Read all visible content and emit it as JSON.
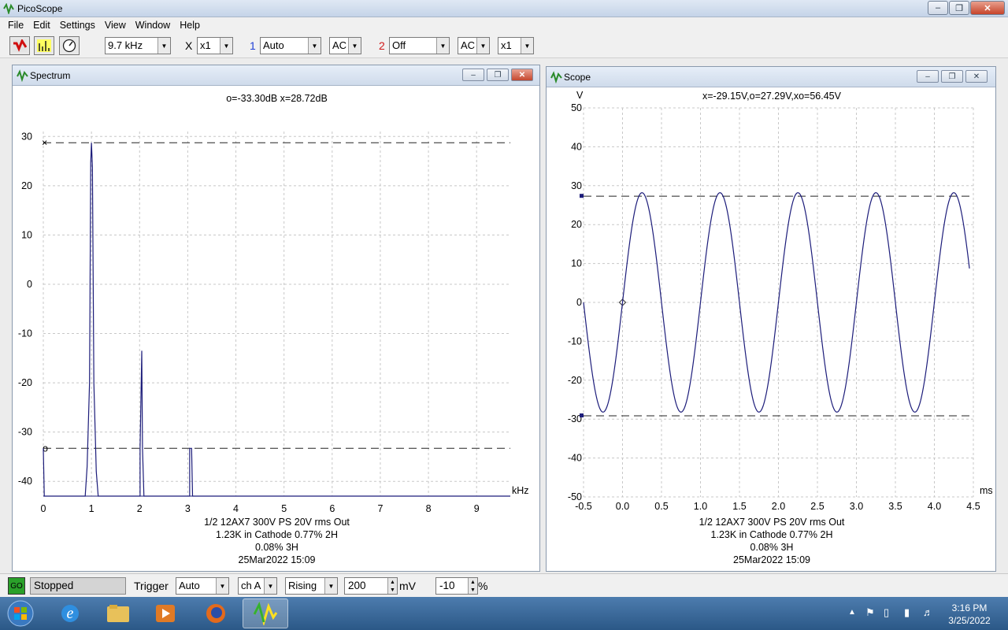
{
  "app": {
    "title": "PicoScope"
  },
  "menu": [
    "File",
    "Edit",
    "Settings",
    "View",
    "Window",
    "Help"
  ],
  "toolbar": {
    "frequency": "9.7 kHz",
    "mult_prefix": "X",
    "multiplier": "x1",
    "ch1_label": "1",
    "ch1_range": "Auto",
    "ch1_coupling": "AC",
    "ch2_label": "2",
    "ch2_range": "Off",
    "ch2_coupling": "AC",
    "multiplier2": "x1"
  },
  "spectrum": {
    "title": "Spectrum",
    "readout": "o=-33.30dB  x=28.72dB",
    "unit_x": "kHz",
    "caption": [
      "1/2 12AX7 300V PS 20V rms Out",
      "1.23K in Cathode  0.77% 2H",
      "0.08% 3H",
      "25Mar2022  15:09"
    ]
  },
  "scope": {
    "title": "Scope",
    "readout": "x=-29.15V,o=27.29V,xo=56.45V",
    "unit_y": "V",
    "unit_x": "ms",
    "caption": [
      "1/2 12AX7 300V PS 20V rms Out",
      "1.23K in Cathode  0.77% 2H",
      "0.08% 3H",
      "25Mar2022  15:09"
    ]
  },
  "chart_data": [
    {
      "type": "line",
      "name": "spectrum",
      "xlabel": "kHz",
      "xlim": [
        0,
        9.7
      ],
      "ylim": [
        -43,
        31
      ],
      "x_ticks": [
        0,
        1,
        2,
        3,
        4,
        5,
        6,
        7,
        8,
        9
      ],
      "y_ticks": [
        30,
        20,
        10,
        0,
        -10,
        -20,
        -30,
        -40
      ],
      "grid": true,
      "peaks": [
        {
          "x": 1.0,
          "y": 28.72
        },
        {
          "x": 2.05,
          "y": -13.5
        },
        {
          "x": 3.07,
          "y": -33.3
        }
      ],
      "floor": -43,
      "cursors": {
        "x": 28.72,
        "o": -33.3
      },
      "line_color": "#1c1c7a"
    },
    {
      "type": "line",
      "name": "scope",
      "xlabel": "ms",
      "ylabel": "V",
      "xlim": [
        -0.5,
        4.5
      ],
      "ylim": [
        -50,
        50
      ],
      "x_ticks": [
        -0.5,
        0.0,
        0.5,
        1.0,
        1.5,
        2.0,
        2.5,
        3.0,
        3.5,
        4.0,
        4.5
      ],
      "y_ticks": [
        50,
        40,
        30,
        20,
        10,
        0,
        -10,
        -20,
        -30,
        -40,
        -50
      ],
      "grid": true,
      "signal": {
        "amplitude": 28.2,
        "frequency_khz": 1.0,
        "phase_shift_ms": 0.0
      },
      "cursors": {
        "x": -29.15,
        "o": 27.29
      },
      "line_color": "#1c1c7a"
    }
  ],
  "status": {
    "go": "GO",
    "state": "Stopped",
    "trigger_label": "Trigger",
    "trigger_mode": "Auto",
    "trigger_channel": "ch A",
    "trigger_edge": "Rising",
    "trigger_level": "200",
    "trigger_level_unit": "mV",
    "pretrigger": "-10",
    "pretrigger_unit": "%"
  },
  "taskbar": {
    "time": "3:16 PM",
    "date": "3/25/2022"
  }
}
